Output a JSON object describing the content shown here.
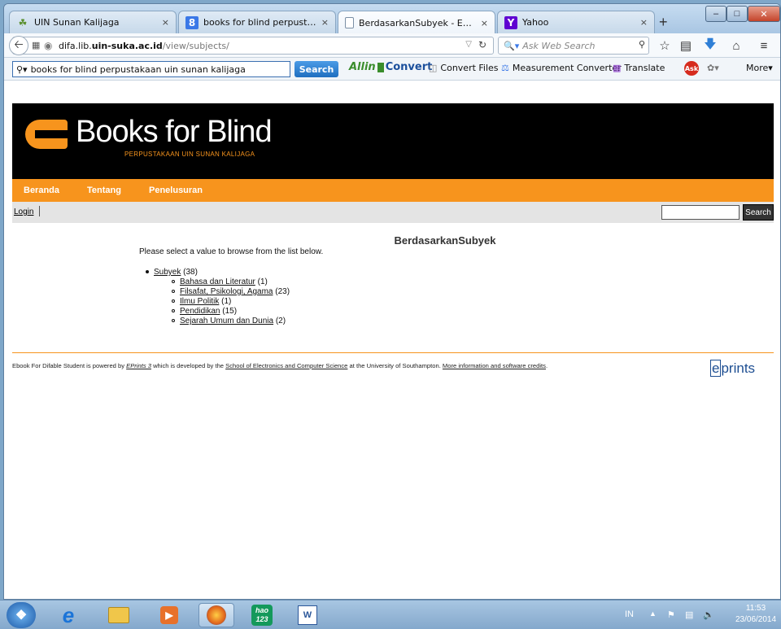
{
  "browser": {
    "tabs": [
      {
        "label": "UIN Sunan Kalijaga",
        "icon": "leaf-icon",
        "active": false
      },
      {
        "label": "books for blind perpustak...",
        "icon": "google-icon",
        "active": false
      },
      {
        "label": "BerdasarkanSubyek - Ebo...",
        "icon": "page-icon",
        "active": true
      },
      {
        "label": "Yahoo",
        "icon": "yahoo-icon",
        "active": false
      }
    ],
    "close_glyph": "×",
    "new_tab_glyph": "+",
    "url_host": "difa.lib.uin-suka.ac.id",
    "url_path": "/view/subjects/",
    "url_prefix": "difa.lib.",
    "url_bold": "uin-suka.ac.id",
    "search_placeholder": "Ask Web Search",
    "toolbar": {
      "search_value": "books for blind perpustakaan uin sunan kalijaga",
      "search_button": "Search",
      "allin": "Allin",
      "convert": "Convert",
      "convert_files": "Convert Files",
      "measurement": "Measurement Converter",
      "translate": "Translate",
      "more": "More"
    }
  },
  "site": {
    "logo_title": "Books for Blind",
    "logo_subtitle": "PERPUSTAKAAN UIN SUNAN KALIJAGA",
    "menu": [
      "Beranda",
      "Tentang",
      "Penelusuran"
    ],
    "login": "Login",
    "search_button": "Search",
    "page_title": "BerdasarkanSubyek",
    "intro": "Please select a value to browse from the list below.",
    "tree": {
      "root_label": "Subyek",
      "root_count": "(38)",
      "children": [
        {
          "label": "Bahasa dan Literatur",
          "count": "(1)"
        },
        {
          "label": "Filsafat, Psikologi, Agama",
          "count": "(23)"
        },
        {
          "label": "Ilmu Politik",
          "count": "(1)"
        },
        {
          "label": "Pendidikan",
          "count": "(15)"
        },
        {
          "label": "Sejarah Umum dan Dunia",
          "count": "(2)"
        }
      ]
    },
    "footer": {
      "part1": "Ebook For Difable Student is powered by ",
      "eprints_link": "EPrints 3",
      "part2": " which is developed by the ",
      "school_link": "School of Electronics and Computer Science",
      "part3": " at the University of Southampton. ",
      "more_link": "More information and software credits",
      "end": "."
    },
    "eprints_logo_e": "e",
    "eprints_logo_rest": "prints"
  },
  "taskbar": {
    "language": "IN",
    "time": "11:53",
    "date": "23/06/2014",
    "hao_label": "hao\n123"
  },
  "colors": {
    "accent_orange": "#f7941d",
    "header_black": "#000000",
    "taskbar_blue": "#84a8cc"
  }
}
